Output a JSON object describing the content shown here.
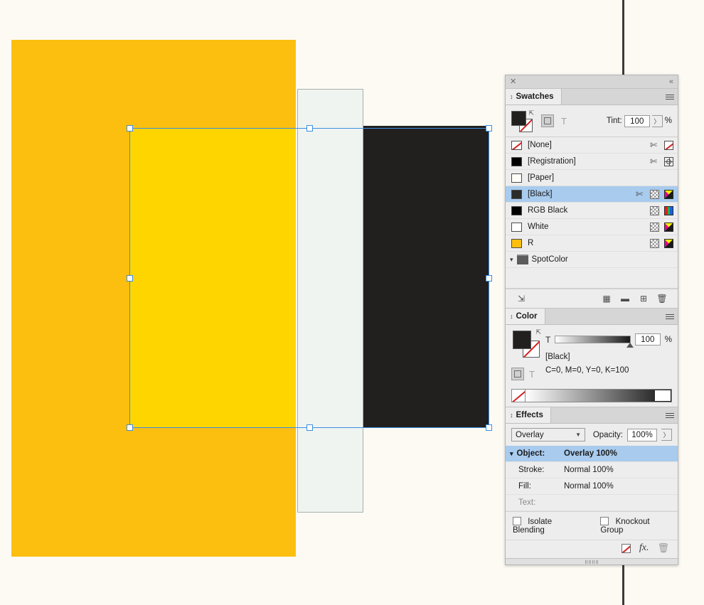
{
  "canvas": {
    "page_background": "#FDFAF4",
    "objects": [
      {
        "name": "yellow-rectangle",
        "fill": "#FCBF10"
      },
      {
        "name": "pale-rectangle",
        "fill": "#EFF4F0",
        "stroke": "#A8B0AC"
      },
      {
        "name": "dark-rectangle",
        "fill": "#221F1F"
      },
      {
        "name": "overlay-blend-region",
        "fill": "#FFD500"
      }
    ],
    "selection": {
      "color": "#3C8EE0",
      "handle_count": 8
    }
  },
  "dock": {
    "close_label": "✕",
    "collapse_label": "«"
  },
  "swatches": {
    "tab_label": "Swatches",
    "tint_label": "Tint:",
    "tint_value": "100",
    "percent_label": "%",
    "apply_text_label": "T",
    "fill_color": "#221F1F",
    "stroke_color": "[None]",
    "rows": [
      {
        "name": "[None]",
        "chip": "none",
        "color": "#FFFFFF",
        "dropper": true,
        "check": false,
        "mode": "none",
        "selected": false
      },
      {
        "name": "[Registration]",
        "chip": "solid",
        "color": "#000000",
        "dropper": true,
        "check": false,
        "mode": "spot",
        "selected": false
      },
      {
        "name": "[Paper]",
        "chip": "solid",
        "color": "#FFFDF7",
        "dropper": false,
        "check": false,
        "mode": "none",
        "selected": false
      },
      {
        "name": "[Black]",
        "chip": "solid",
        "color": "#2B2B2B",
        "dropper": true,
        "check": true,
        "mode": "cmyk",
        "selected": true
      },
      {
        "name": "RGB Black",
        "chip": "solid",
        "color": "#000000",
        "dropper": false,
        "check": true,
        "mode": "rgb",
        "selected": false
      },
      {
        "name": "White",
        "chip": "solid",
        "color": "#FFFFFF",
        "dropper": false,
        "check": true,
        "mode": "cmyk",
        "selected": false
      },
      {
        "name": "R",
        "chip": "solid",
        "color": "#FCBF10",
        "dropper": false,
        "check": true,
        "mode": "cmyk",
        "selected": false
      }
    ],
    "group": {
      "name": "SpotColor"
    },
    "toolbar": {
      "show_swatches_label": "⇲",
      "new_color_group_label": "▦",
      "new_folder_label": "▬",
      "new_swatch_label": "⊞",
      "delete_label": "Ὕ1"
    }
  },
  "color": {
    "tab_label": "Color",
    "t_letter": "T",
    "tint_value": "100",
    "percent_label": "%",
    "swatch_name": "[Black]",
    "color_values": "C=0, M=0, Y=0, K=100",
    "apply_text_label": "T",
    "fill_color": "#221F1F"
  },
  "effects": {
    "tab_label": "Effects",
    "blend_mode": "Overlay",
    "opacity_label": "Opacity:",
    "opacity_value": "100%",
    "rows": [
      {
        "label": "Object:",
        "value": "Overlay 100%",
        "selected": true,
        "muted": false
      },
      {
        "label": "Stroke:",
        "value": "Normal 100%",
        "selected": false,
        "muted": false
      },
      {
        "label": "Fill:",
        "value": "Normal 100%",
        "selected": false,
        "muted": false
      },
      {
        "label": "Text:",
        "value": "",
        "selected": false,
        "muted": true
      }
    ],
    "isolate_blending_label": "Isolate Blending",
    "knockout_group_label": "Knockout Group",
    "fx_label": "fx.",
    "clear_effects_label": "",
    "delete_label": "Ὕ1"
  }
}
